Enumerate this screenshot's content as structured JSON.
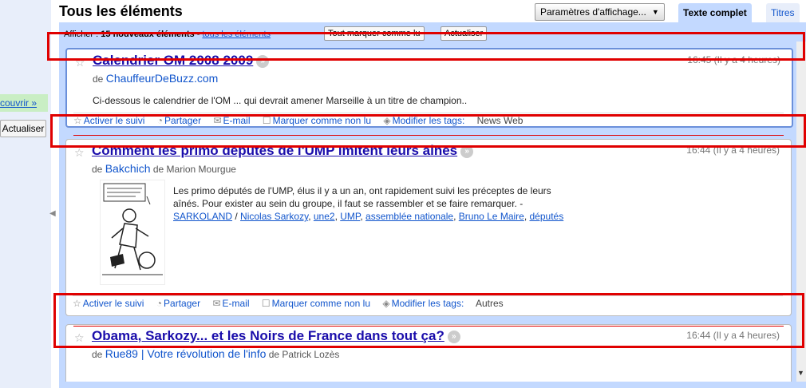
{
  "sidebar": {
    "discover_label": "couvrir »",
    "refresh_label": "Actualiser"
  },
  "header": {
    "title": "Tous les éléments",
    "display_settings": "Paramètres d'affichage...",
    "tab_full": "Texte complet",
    "tab_titles": "Titres"
  },
  "toolbar": {
    "show_label": "Afficher :",
    "new_count": "15 nouveaux éléments",
    "sep": " - ",
    "all_items": "tous les éléments",
    "mark_all_read": "Tout marquer comme lu",
    "refresh": "Actualiser"
  },
  "entries": [
    {
      "title": "Calendrier OM 2008 2009",
      "time": "16:45 (Il y a 4 heures)",
      "source_prefix": "de",
      "source": "ChauffeurDeBuzz.com",
      "author": "",
      "body": "Ci-dessous le calendrier de l'OM ... qui devrait amener Marseille à un titre de champion..",
      "actions": {
        "follow": "Activer le suivi",
        "share": "Partager",
        "email": "E-mail",
        "mark_unread": "Marquer comme non lu",
        "edit_tags": "Modifier les tags:",
        "tags_value": "News Web"
      }
    },
    {
      "title": "Comment les primo députés de l'UMP imitent leurs aînés",
      "time": "16:44 (Il y a 4 heures)",
      "source_prefix": "de",
      "source": "Bakchich",
      "author": "de Marion Mourgue",
      "body": "Les primo députés de l'UMP, élus il y a un an, ont rapidement suivi les préceptes de leurs aînés. Pour exister au sein du groupe, il faut se rassembler et se faire remarquer. - ",
      "links": [
        "SARKOLAND",
        "Nicolas Sarkozy",
        "une2",
        "UMP",
        "assemblée nationale",
        "Bruno Le Maire",
        "députés"
      ],
      "actions": {
        "follow": "Activer le suivi",
        "share": "Partager",
        "email": "E-mail",
        "mark_unread": "Marquer comme non lu",
        "edit_tags": "Modifier les tags:",
        "tags_value": "Autres"
      }
    },
    {
      "title": "Obama, Sarkozy... et les Noirs de France dans tout ça?",
      "time": "16:44 (Il y a 4 heures)",
      "source_prefix": "de",
      "source": "Rue89 | Votre révolution de l'info",
      "author": "de Patrick Lozès"
    }
  ],
  "icons": {
    "star": "star-icon",
    "share": "share-icon",
    "email": "email-icon",
    "checkbox": "checkbox-icon",
    "tag": "tag-icon",
    "more": "expand-icon"
  },
  "colors": {
    "accent": "#c3d9ff",
    "link": "#1155cc",
    "title": "#1a0dab",
    "highlight": "#e00000"
  }
}
